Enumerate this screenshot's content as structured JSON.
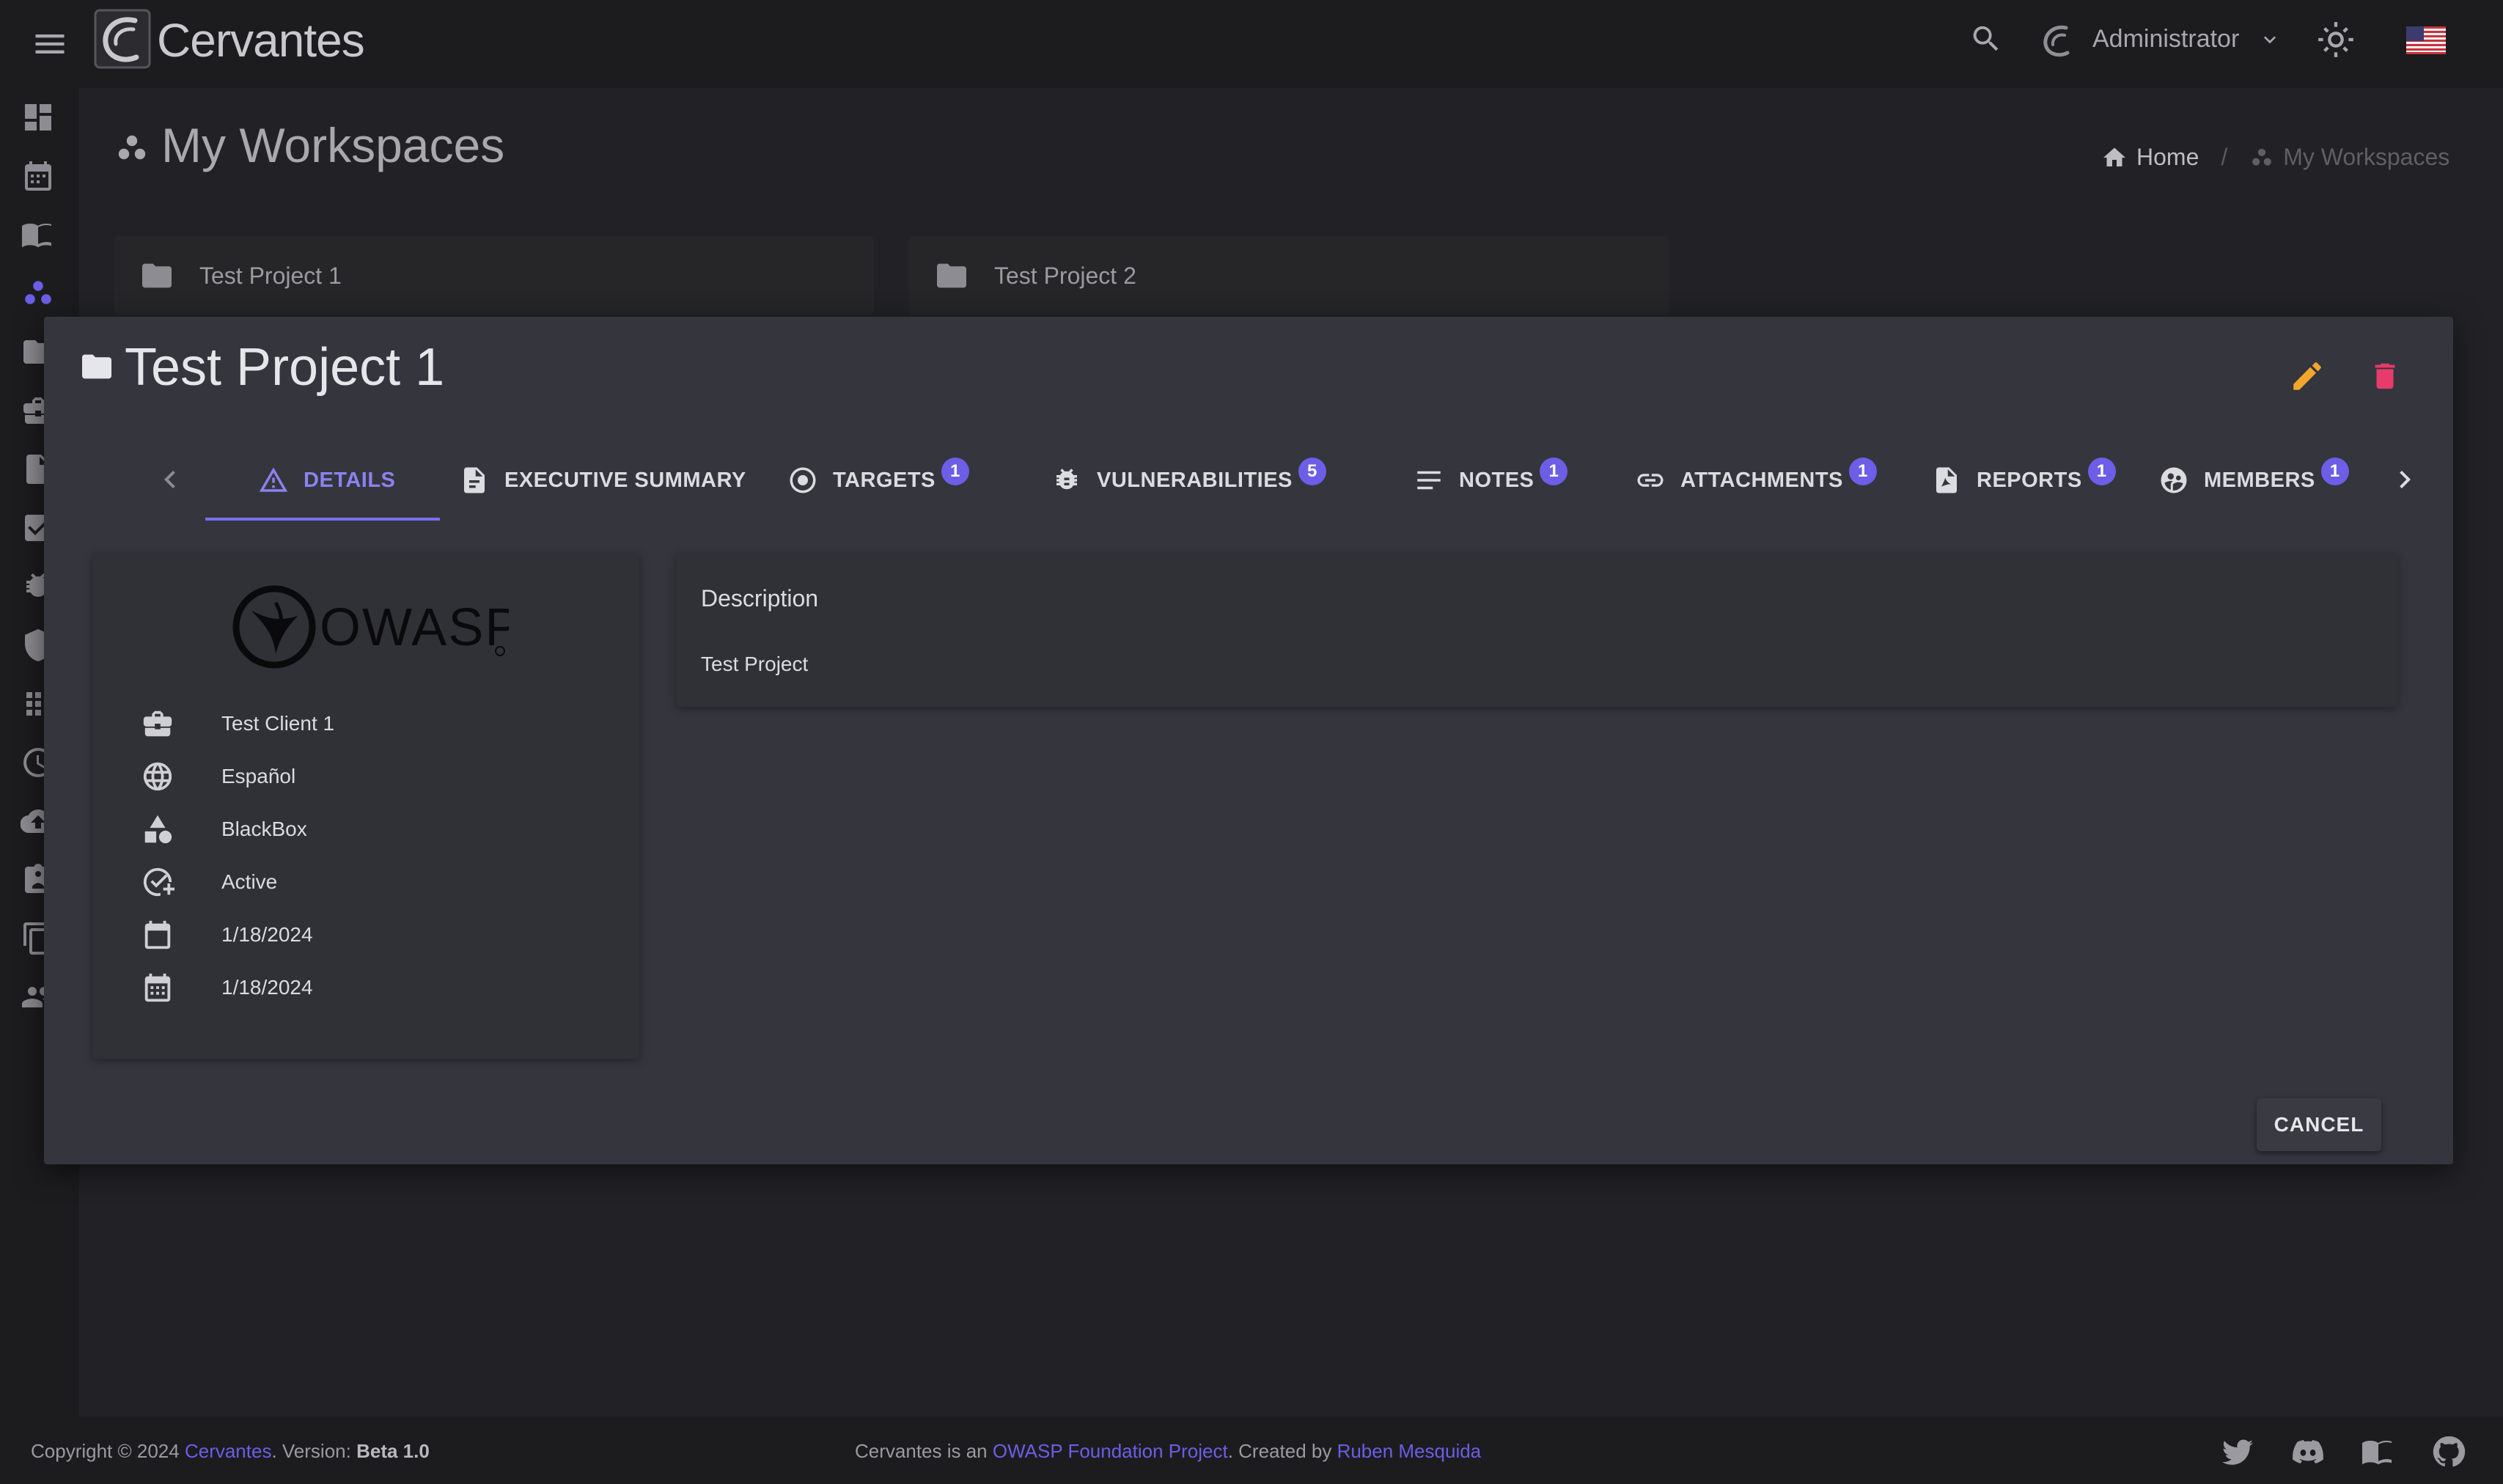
{
  "app": {
    "brand": "Cervantes"
  },
  "header": {
    "user": "Administrator"
  },
  "page": {
    "title": "My Workspaces",
    "breadcrumb": {
      "home": "Home",
      "current": "My Workspaces"
    },
    "workspaces": [
      {
        "name": "Test Project 1"
      },
      {
        "name": "Test Project 2"
      }
    ]
  },
  "dialog": {
    "title": "Test Project 1",
    "tabs": [
      {
        "label": "DETAILS",
        "badge": null
      },
      {
        "label": "EXECUTIVE SUMMARY",
        "badge": null
      },
      {
        "label": "TARGETS",
        "badge": "1"
      },
      {
        "label": "VULNERABILITIES",
        "badge": "5"
      },
      {
        "label": "NOTES",
        "badge": "1"
      },
      {
        "label": "ATTACHMENTS",
        "badge": "1"
      },
      {
        "label": "REPORTS",
        "badge": "1"
      },
      {
        "label": "MEMBERS",
        "badge": "1"
      }
    ],
    "details": {
      "client": "Test Client 1",
      "language": "Español",
      "test_type": "BlackBox",
      "status": "Active",
      "start_date": "1/18/2024",
      "end_date": "1/18/2024"
    },
    "description": {
      "label": "Description",
      "text": "Test Project"
    },
    "cancel_label": "CANCEL"
  },
  "footer": {
    "copyright": "Copyright © 2024 ",
    "brand_link": "Cervantes",
    "version_label": ". Version: ",
    "version": "Beta 1.0",
    "center_text_1": "Cervantes is an ",
    "owasp_link": "OWASP Foundation Project",
    "center_text_2": ". Created by ",
    "author_link": "Ruben Mesquida"
  },
  "colors": {
    "accent": "#6c5ee6",
    "edit": "#f3a62b",
    "delete": "#e63b6b"
  }
}
